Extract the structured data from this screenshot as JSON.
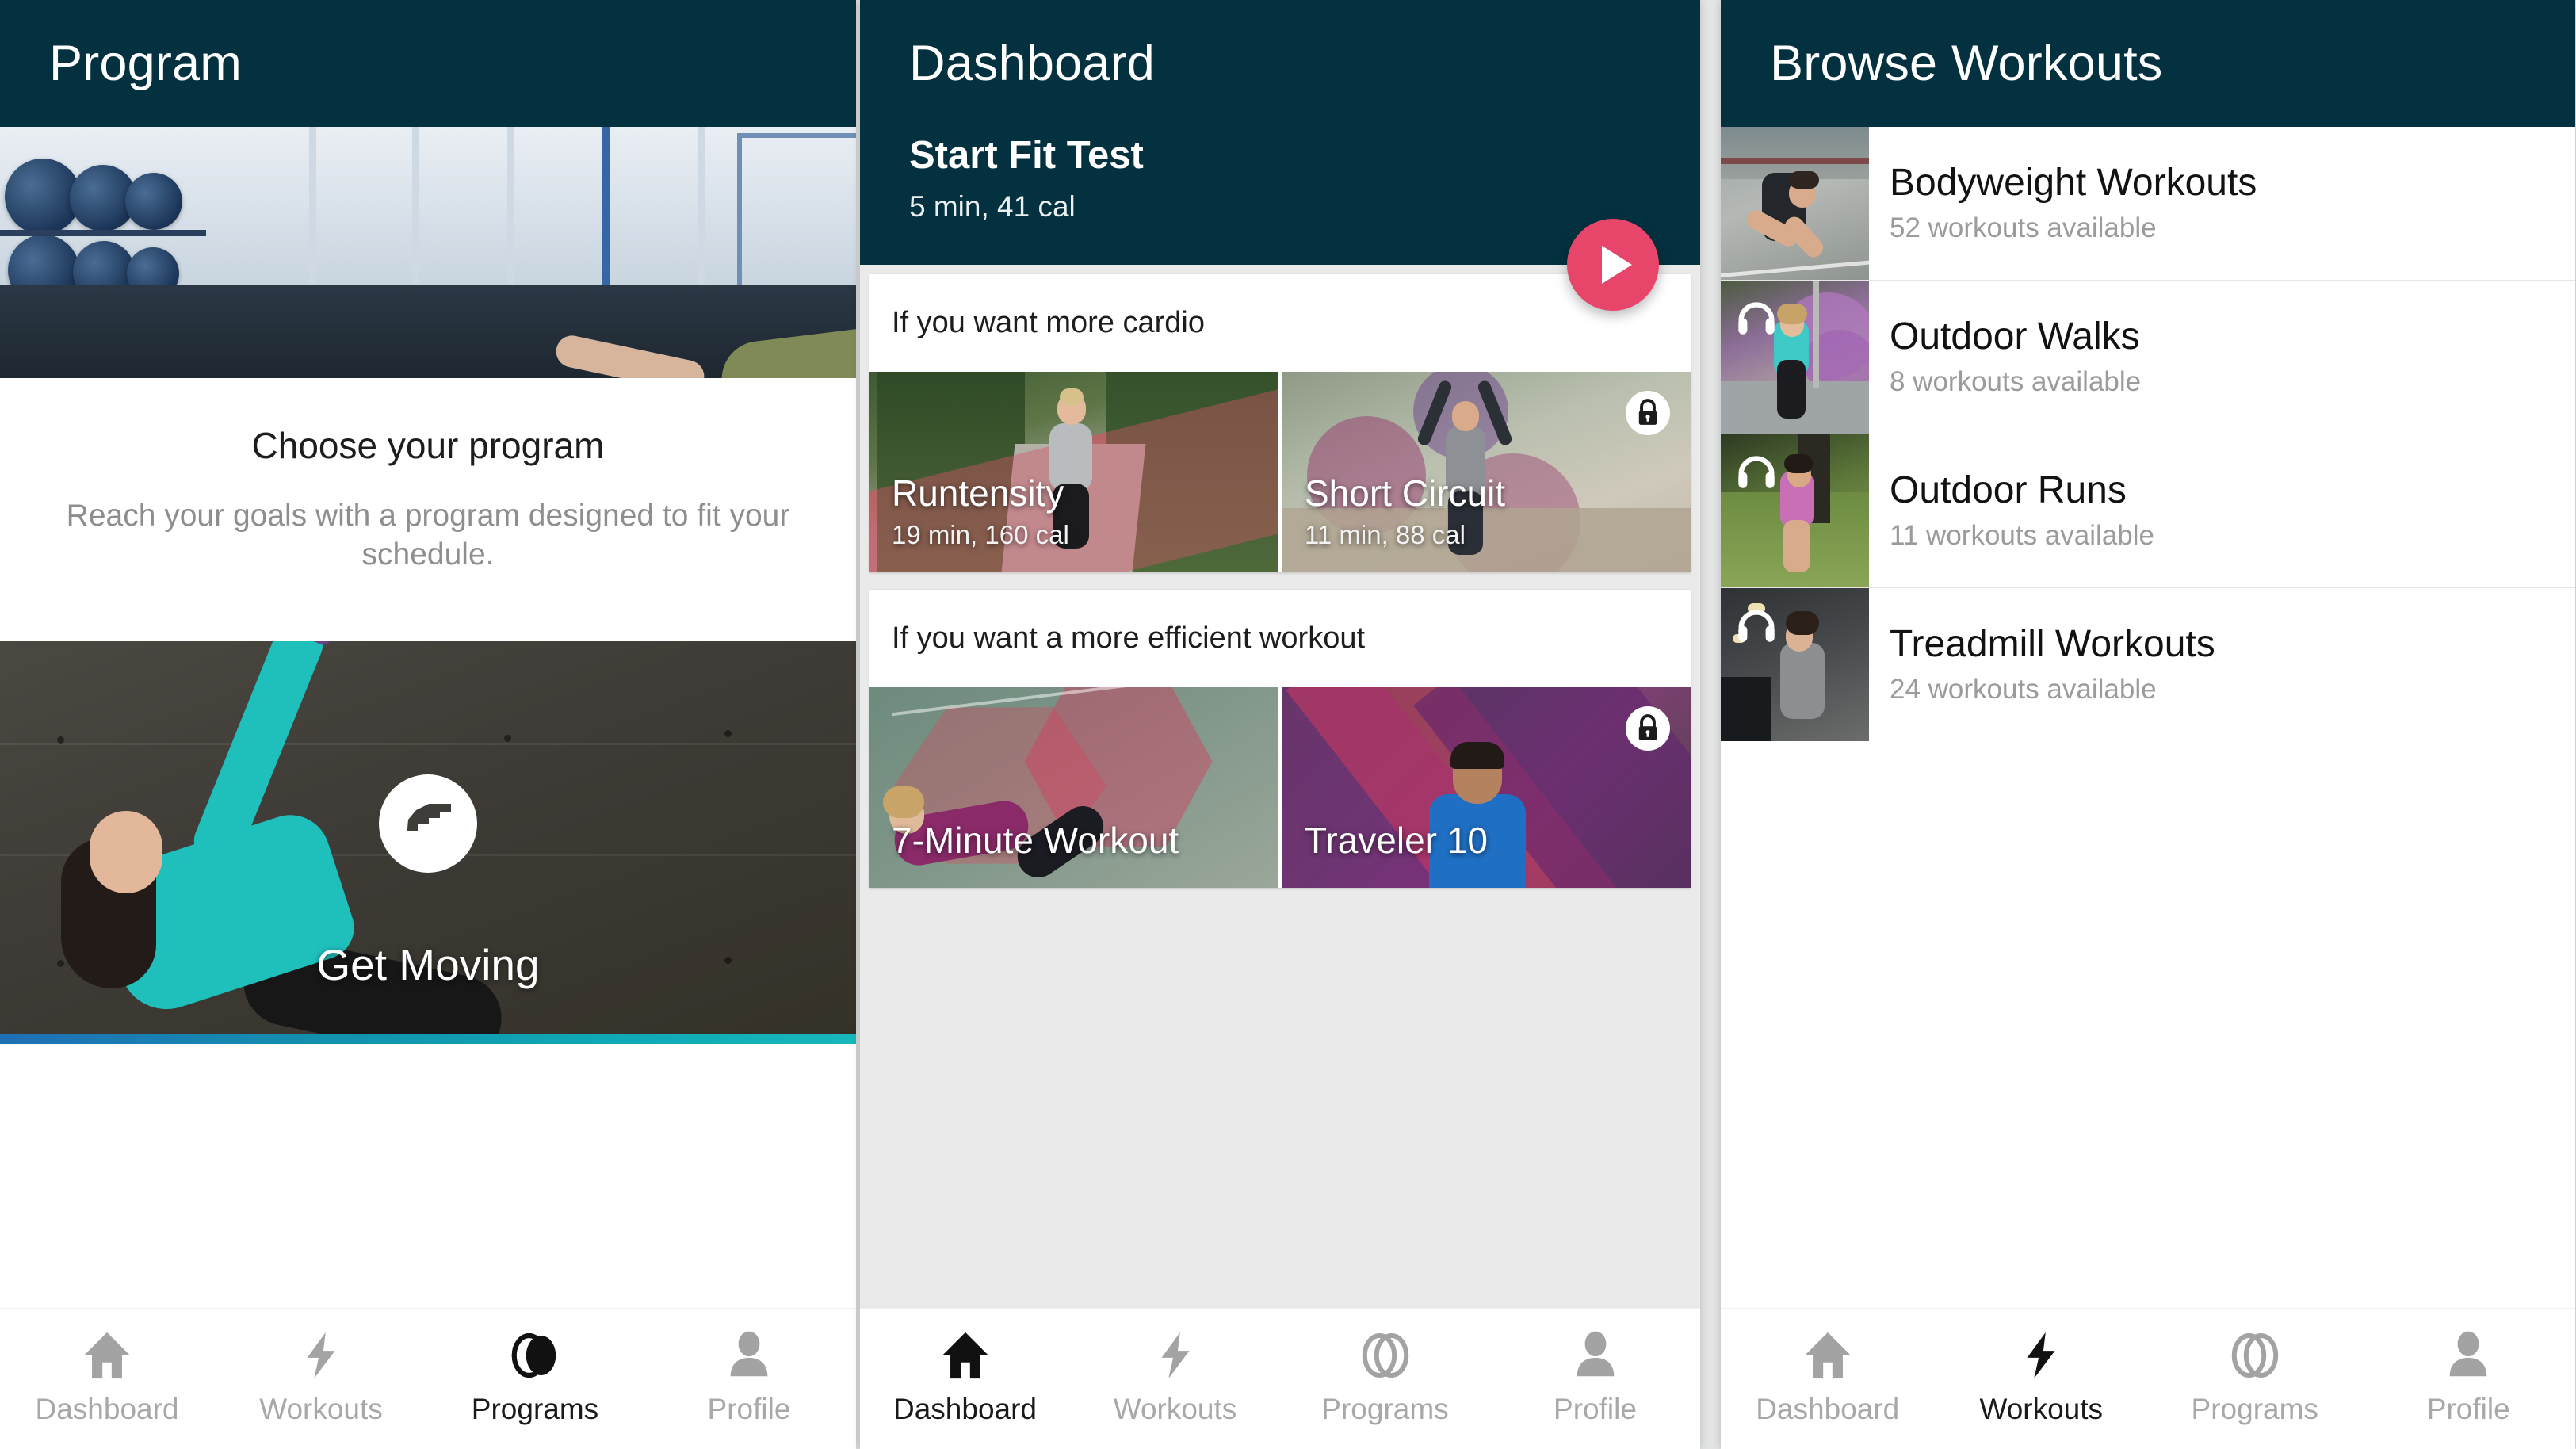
{
  "background_color": "#e3e4e4",
  "theme": {
    "header_bg": "#04313f",
    "accent_pink": "#e8456b",
    "muted_text": "#9b9b9b",
    "active_text": "#1a1a1a",
    "progress_gradient_start": "#1f6fb5",
    "progress_gradient_end": "#17b7bb"
  },
  "panel_program": {
    "appbar": {
      "title": "Program"
    },
    "hero_image_alt": "woman doing plank exercise next to dumbbell rack",
    "section": {
      "title": "Choose your program",
      "subtitle": "Reach your goals with a program designed to fit your schedule."
    },
    "program_card": {
      "label": "Get Moving",
      "logo_icon": "stairs-circle-icon",
      "image_alt": "woman doing side plank against concrete wall"
    },
    "bottom_nav": {
      "items": [
        {
          "label": "Dashboard",
          "icon": "home-icon",
          "active": false
        },
        {
          "label": "Workouts",
          "icon": "bolt-icon",
          "active": false
        },
        {
          "label": "Programs",
          "icon": "rings-icon",
          "active": true
        },
        {
          "label": "Profile",
          "icon": "person-icon",
          "active": false
        }
      ]
    }
  },
  "panel_dashboard": {
    "appbar": {
      "title": "Dashboard"
    },
    "hero": {
      "title": "Start Fit Test",
      "subtitle": "5 min, 41 cal",
      "play_button_icon": "play-icon"
    },
    "sections": [
      {
        "heading": "If you want more cardio",
        "tiles": [
          {
            "title": "Runtensity",
            "meta": "19 min, 160 cal",
            "locked": false,
            "image_alt": "woman running down outdoor stairs"
          },
          {
            "title": "Short Circuit",
            "meta": "11 min, 88 cal",
            "locked": true,
            "lock_icon": "lock-icon",
            "image_alt": "woman jumping with arms raised outdoors"
          }
        ]
      },
      {
        "heading": "If you want a more efficient workout",
        "tiles": [
          {
            "title": "7-Minute Workout",
            "meta": "",
            "locked": false,
            "image_alt": "woman doing sit-ups on outdoor court"
          },
          {
            "title": "Traveler 10",
            "meta": "",
            "locked": true,
            "lock_icon": "lock-icon",
            "image_alt": "man in blue shirt resting"
          }
        ]
      }
    ],
    "bottom_nav": {
      "items": [
        {
          "label": "Dashboard",
          "icon": "home-icon",
          "active": true
        },
        {
          "label": "Workouts",
          "icon": "bolt-icon",
          "active": false
        },
        {
          "label": "Programs",
          "icon": "rings-icon",
          "active": false
        },
        {
          "label": "Profile",
          "icon": "person-icon",
          "active": false
        }
      ]
    }
  },
  "panel_browse": {
    "appbar": {
      "title": "Browse Workouts"
    },
    "rows": [
      {
        "title": "Bodyweight Workouts",
        "subtitle": "52 workouts available",
        "has_headphones": false,
        "image_alt": "man in sprint start position on court"
      },
      {
        "title": "Outdoor Walks",
        "subtitle": "8 workouts available",
        "has_headphones": true,
        "headphones_icon": "headphones-icon",
        "image_alt": "woman walking past purple flowers checking watch"
      },
      {
        "title": "Outdoor Runs",
        "subtitle": "11 workouts available",
        "has_headphones": true,
        "headphones_icon": "headphones-icon",
        "image_alt": "woman running through tall grass"
      },
      {
        "title": "Treadmill Workouts",
        "subtitle": "24 workouts available",
        "has_headphones": true,
        "headphones_icon": "headphones-icon",
        "image_alt": "woman running on treadmill in gym"
      }
    ],
    "bottom_nav": {
      "items": [
        {
          "label": "Dashboard",
          "icon": "home-icon",
          "active": false
        },
        {
          "label": "Workouts",
          "icon": "bolt-icon",
          "active": true
        },
        {
          "label": "Programs",
          "icon": "rings-icon",
          "active": false
        },
        {
          "label": "Profile",
          "icon": "person-icon",
          "active": false
        }
      ]
    }
  }
}
